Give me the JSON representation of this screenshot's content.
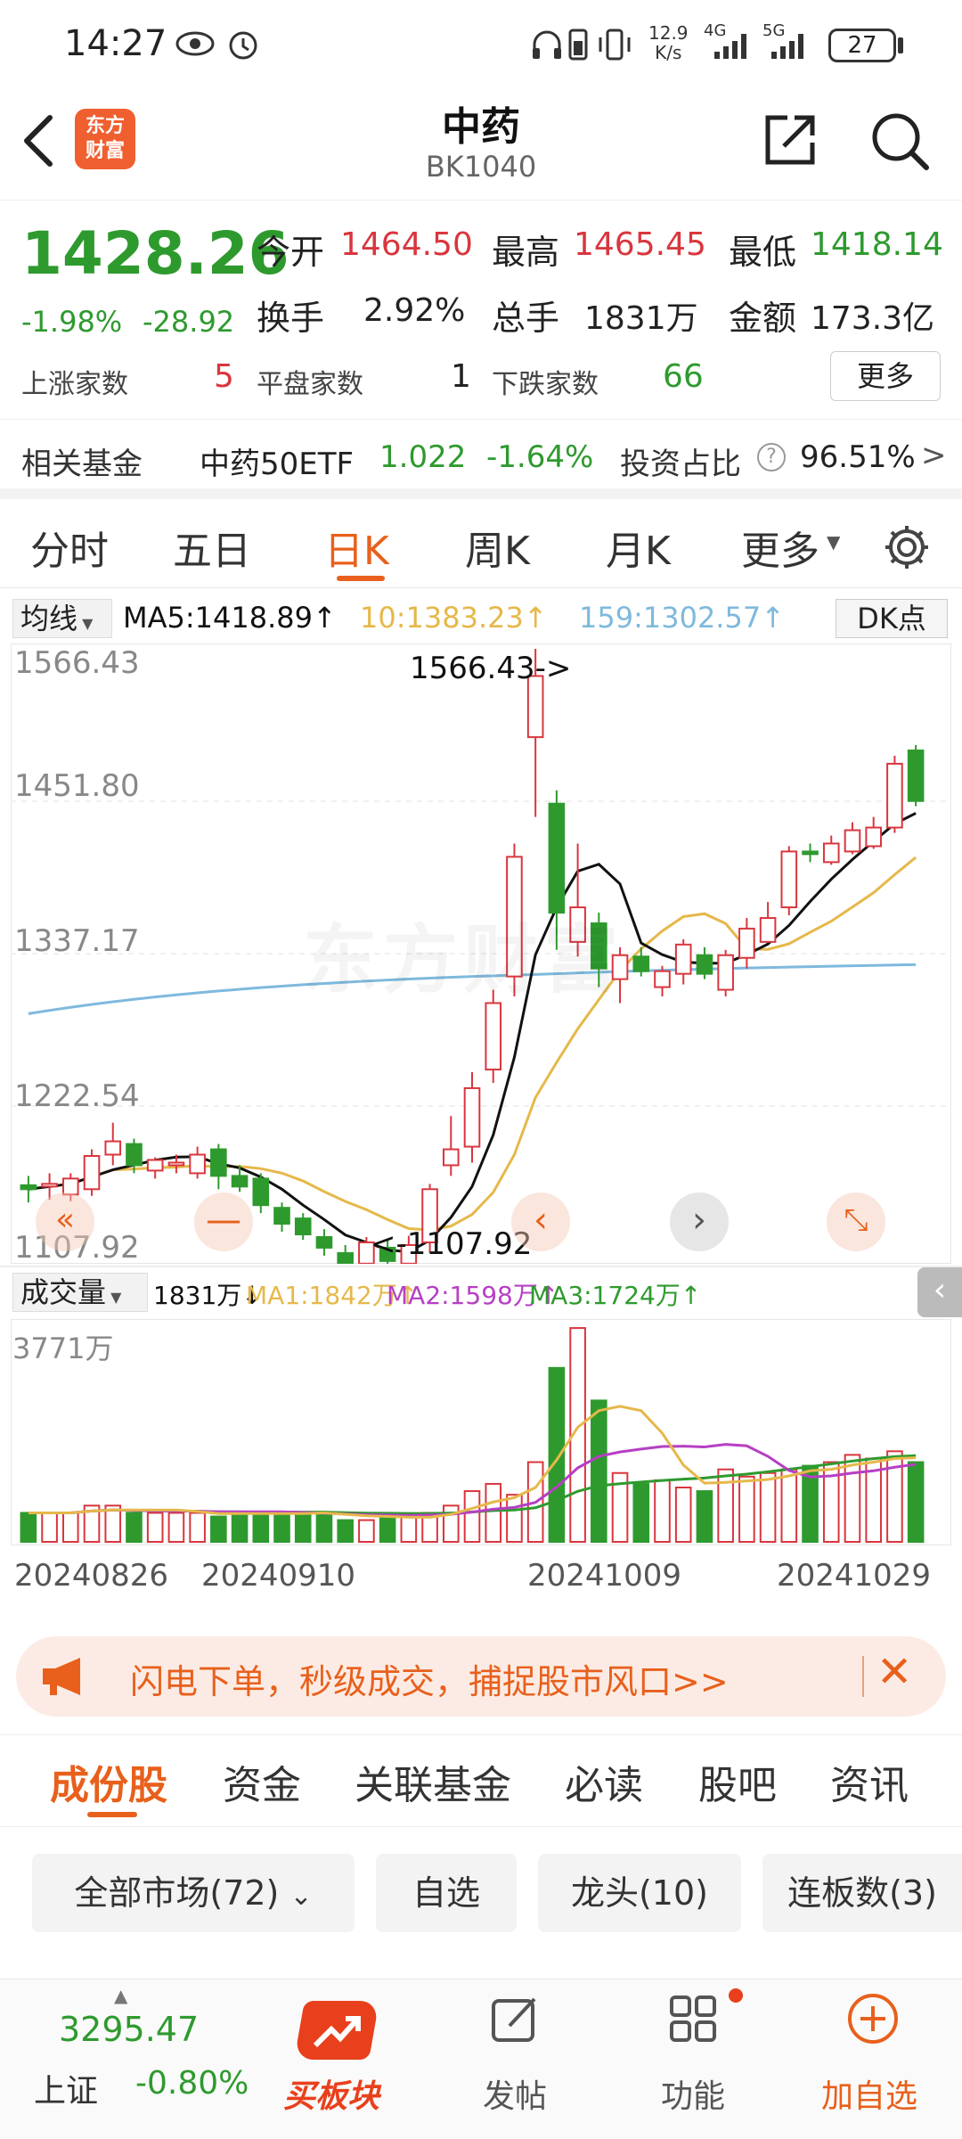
{
  "status_bar": {
    "time": "14:27",
    "net_speed_top": "12.9",
    "net_speed_bottom": "K/s",
    "signal1": "4G",
    "signal2": "5G",
    "battery": "27"
  },
  "header": {
    "logo_line1": "东方",
    "logo_line2": "财富",
    "title": "中药",
    "code": "BK1040"
  },
  "quote": {
    "price": "1428.26",
    "change_pct": "-1.98%",
    "change": "-28.92",
    "open_label": "今开",
    "open": "1464.50",
    "high_label": "最高",
    "high": "1465.45",
    "low_label": "最低",
    "low": "1418.14",
    "turnover_label": "换手",
    "turnover": "2.92%",
    "volume_label": "总手",
    "volume": "1831万",
    "amount_label": "金额",
    "amount": "173.3亿",
    "up_label": "上涨家数",
    "up_count": "5",
    "flat_label": "平盘家数",
    "flat_count": "1",
    "down_label": "下跌家数",
    "down_count": "66",
    "more_button": "更多"
  },
  "fund_bar": {
    "label": "相关基金",
    "fund_name": "中药50ETF",
    "fund_price": "1.022",
    "fund_change": "-1.64%",
    "ratio_label": "投资占比",
    "ratio_value": "96.51%",
    "arrow": ">"
  },
  "period_tabs": [
    "分时",
    "五日",
    "日K",
    "周K",
    "月K",
    "更多"
  ],
  "active_tab": "日K",
  "kline": {
    "ma_select": "均线",
    "ma5": "MA5:1418.89↑",
    "ma10": "10:1383.23↑",
    "ma159": "159:1302.57↑",
    "dk_button": "DK点",
    "y_labels": [
      "1566.43",
      "1451.80",
      "1337.17",
      "1222.54",
      "1107.92"
    ],
    "max_marker": "1566.43->",
    "min_marker": "<-1107.92",
    "watermark": "东方财富",
    "colors": {
      "up": "#d9363e",
      "down": "#2e9a2e",
      "ma5": "#111111",
      "ma10": "#e6b84a",
      "ma159": "#7fb9dd"
    }
  },
  "volume": {
    "select": "成交量",
    "value": "1831万↓",
    "ma1": "MA1:1842万↑",
    "ma2": "MA2:1598万↑",
    "ma3": "MA3:1724万↑",
    "top_label": "3771万",
    "dates": [
      "20240826",
      "20240910",
      "20241009",
      "20241029"
    ],
    "colors": {
      "ma1": "#e6b84a",
      "ma2": "#b63fc4",
      "ma3": "#2e9a2e"
    }
  },
  "chart_data": {
    "type": "candlestick",
    "ylim": [
      1107.92,
      1566.43
    ],
    "candles": [
      {
        "o": 1163,
        "h": 1170,
        "l": 1150,
        "c": 1160
      },
      {
        "o": 1162,
        "h": 1172,
        "l": 1152,
        "c": 1164
      },
      {
        "o": 1156,
        "h": 1172,
        "l": 1151,
        "c": 1168
      },
      {
        "o": 1160,
        "h": 1190,
        "l": 1155,
        "c": 1185
      },
      {
        "o": 1186,
        "h": 1210,
        "l": 1178,
        "c": 1196
      },
      {
        "o": 1194,
        "h": 1198,
        "l": 1172,
        "c": 1178
      },
      {
        "o": 1174,
        "h": 1184,
        "l": 1168,
        "c": 1182
      },
      {
        "o": 1178,
        "h": 1186,
        "l": 1172,
        "c": 1180
      },
      {
        "o": 1172,
        "h": 1192,
        "l": 1168,
        "c": 1186
      },
      {
        "o": 1190,
        "h": 1194,
        "l": 1160,
        "c": 1170
      },
      {
        "o": 1170,
        "h": 1178,
        "l": 1158,
        "c": 1162
      },
      {
        "o": 1168,
        "h": 1172,
        "l": 1142,
        "c": 1148
      },
      {
        "o": 1146,
        "h": 1150,
        "l": 1128,
        "c": 1134
      },
      {
        "o": 1138,
        "h": 1142,
        "l": 1122,
        "c": 1126
      },
      {
        "o": 1124,
        "h": 1130,
        "l": 1110,
        "c": 1116
      },
      {
        "o": 1112,
        "h": 1118,
        "l": 1100,
        "c": 1104
      },
      {
        "o": 1104,
        "h": 1124,
        "l": 1108,
        "c": 1120
      },
      {
        "o": 1116,
        "h": 1122,
        "l": 1100,
        "c": 1106
      },
      {
        "o": 1104,
        "h": 1125,
        "l": 1108,
        "c": 1118
      },
      {
        "o": 1120,
        "h": 1164,
        "l": 1112,
        "c": 1160
      },
      {
        "o": 1178,
        "h": 1215,
        "l": 1170,
        "c": 1190
      },
      {
        "o": 1192,
        "h": 1248,
        "l": 1180,
        "c": 1236
      },
      {
        "o": 1250,
        "h": 1310,
        "l": 1240,
        "c": 1300
      },
      {
        "o": 1320,
        "h": 1420,
        "l": 1305,
        "c": 1410
      },
      {
        "o": 1500,
        "h": 1566.43,
        "l": 1440,
        "c": 1546
      },
      {
        "o": 1450,
        "h": 1460,
        "l": 1340,
        "c": 1368
      },
      {
        "o": 1346,
        "h": 1420,
        "l": 1335,
        "c": 1372
      },
      {
        "o": 1360,
        "h": 1368,
        "l": 1312,
        "c": 1326
      },
      {
        "o": 1318,
        "h": 1342,
        "l": 1300,
        "c": 1336
      },
      {
        "o": 1335,
        "h": 1342,
        "l": 1320,
        "c": 1324
      },
      {
        "o": 1312,
        "h": 1328,
        "l": 1305,
        "c": 1324
      },
      {
        "o": 1322,
        "h": 1348,
        "l": 1314,
        "c": 1344
      },
      {
        "o": 1336,
        "h": 1342,
        "l": 1318,
        "c": 1322
      },
      {
        "o": 1310,
        "h": 1340,
        "l": 1305,
        "c": 1336
      },
      {
        "o": 1334,
        "h": 1364,
        "l": 1326,
        "c": 1356
      },
      {
        "o": 1346,
        "h": 1376,
        "l": 1346,
        "c": 1364
      },
      {
        "o": 1372,
        "h": 1418,
        "l": 1366,
        "c": 1414
      },
      {
        "o": 1414,
        "h": 1420,
        "l": 1406,
        "c": 1412
      },
      {
        "o": 1406,
        "h": 1426,
        "l": 1404,
        "c": 1420
      },
      {
        "o": 1414,
        "h": 1436,
        "l": 1412,
        "c": 1430
      },
      {
        "o": 1418,
        "h": 1440,
        "l": 1416,
        "c": 1432
      },
      {
        "o": 1432,
        "h": 1486,
        "l": 1428,
        "c": 1480
      },
      {
        "o": 1490,
        "h": 1494,
        "l": 1448,
        "c": 1452
      }
    ],
    "volumes": [
      8,
      8,
      8,
      10,
      10,
      8,
      8,
      8,
      8,
      7,
      8,
      8,
      8,
      8,
      8,
      6,
      6,
      7,
      7,
      8,
      10,
      14,
      16,
      13,
      22,
      48,
      59,
      39,
      19,
      16,
      17,
      15,
      14,
      20,
      18,
      19,
      20,
      21,
      22,
      24,
      23,
      25,
      22
    ],
    "vol_ylim": [
      0,
      60
    ]
  },
  "banner": {
    "text": "闪电下单，秒级成交，捕捉股市风口>>"
  },
  "content_tabs": [
    "成份股",
    "资金",
    "关联基金",
    "必读",
    "股吧",
    "资讯"
  ],
  "filter_chips": [
    "全部市场(72)",
    "自选",
    "龙头(10)",
    "连板数(3)"
  ],
  "bottom_nav": {
    "index_value": "3295.47",
    "index_name": "上证",
    "index_change": "-0.80%",
    "items": [
      "买板块",
      "发帖",
      "功能",
      "加自选"
    ]
  }
}
